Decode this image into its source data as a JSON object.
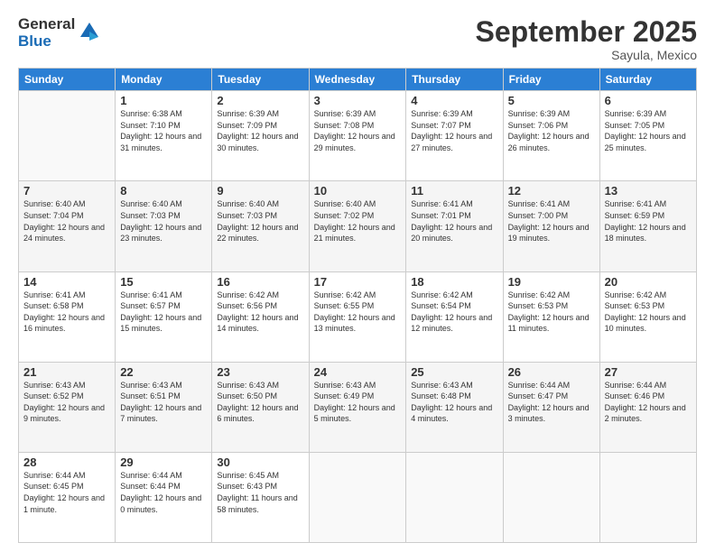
{
  "header": {
    "logo_general": "General",
    "logo_blue": "Blue",
    "month_title": "September 2025",
    "location": "Sayula, Mexico"
  },
  "days_of_week": [
    "Sunday",
    "Monday",
    "Tuesday",
    "Wednesday",
    "Thursday",
    "Friday",
    "Saturday"
  ],
  "weeks": [
    [
      {
        "day": "",
        "sunrise": "",
        "sunset": "",
        "daylight": ""
      },
      {
        "day": "1",
        "sunrise": "Sunrise: 6:38 AM",
        "sunset": "Sunset: 7:10 PM",
        "daylight": "Daylight: 12 hours and 31 minutes."
      },
      {
        "day": "2",
        "sunrise": "Sunrise: 6:39 AM",
        "sunset": "Sunset: 7:09 PM",
        "daylight": "Daylight: 12 hours and 30 minutes."
      },
      {
        "day": "3",
        "sunrise": "Sunrise: 6:39 AM",
        "sunset": "Sunset: 7:08 PM",
        "daylight": "Daylight: 12 hours and 29 minutes."
      },
      {
        "day": "4",
        "sunrise": "Sunrise: 6:39 AM",
        "sunset": "Sunset: 7:07 PM",
        "daylight": "Daylight: 12 hours and 27 minutes."
      },
      {
        "day": "5",
        "sunrise": "Sunrise: 6:39 AM",
        "sunset": "Sunset: 7:06 PM",
        "daylight": "Daylight: 12 hours and 26 minutes."
      },
      {
        "day": "6",
        "sunrise": "Sunrise: 6:39 AM",
        "sunset": "Sunset: 7:05 PM",
        "daylight": "Daylight: 12 hours and 25 minutes."
      }
    ],
    [
      {
        "day": "7",
        "sunrise": "Sunrise: 6:40 AM",
        "sunset": "Sunset: 7:04 PM",
        "daylight": "Daylight: 12 hours and 24 minutes."
      },
      {
        "day": "8",
        "sunrise": "Sunrise: 6:40 AM",
        "sunset": "Sunset: 7:03 PM",
        "daylight": "Daylight: 12 hours and 23 minutes."
      },
      {
        "day": "9",
        "sunrise": "Sunrise: 6:40 AM",
        "sunset": "Sunset: 7:03 PM",
        "daylight": "Daylight: 12 hours and 22 minutes."
      },
      {
        "day": "10",
        "sunrise": "Sunrise: 6:40 AM",
        "sunset": "Sunset: 7:02 PM",
        "daylight": "Daylight: 12 hours and 21 minutes."
      },
      {
        "day": "11",
        "sunrise": "Sunrise: 6:41 AM",
        "sunset": "Sunset: 7:01 PM",
        "daylight": "Daylight: 12 hours and 20 minutes."
      },
      {
        "day": "12",
        "sunrise": "Sunrise: 6:41 AM",
        "sunset": "Sunset: 7:00 PM",
        "daylight": "Daylight: 12 hours and 19 minutes."
      },
      {
        "day": "13",
        "sunrise": "Sunrise: 6:41 AM",
        "sunset": "Sunset: 6:59 PM",
        "daylight": "Daylight: 12 hours and 18 minutes."
      }
    ],
    [
      {
        "day": "14",
        "sunrise": "Sunrise: 6:41 AM",
        "sunset": "Sunset: 6:58 PM",
        "daylight": "Daylight: 12 hours and 16 minutes."
      },
      {
        "day": "15",
        "sunrise": "Sunrise: 6:41 AM",
        "sunset": "Sunset: 6:57 PM",
        "daylight": "Daylight: 12 hours and 15 minutes."
      },
      {
        "day": "16",
        "sunrise": "Sunrise: 6:42 AM",
        "sunset": "Sunset: 6:56 PM",
        "daylight": "Daylight: 12 hours and 14 minutes."
      },
      {
        "day": "17",
        "sunrise": "Sunrise: 6:42 AM",
        "sunset": "Sunset: 6:55 PM",
        "daylight": "Daylight: 12 hours and 13 minutes."
      },
      {
        "day": "18",
        "sunrise": "Sunrise: 6:42 AM",
        "sunset": "Sunset: 6:54 PM",
        "daylight": "Daylight: 12 hours and 12 minutes."
      },
      {
        "day": "19",
        "sunrise": "Sunrise: 6:42 AM",
        "sunset": "Sunset: 6:53 PM",
        "daylight": "Daylight: 12 hours and 11 minutes."
      },
      {
        "day": "20",
        "sunrise": "Sunrise: 6:42 AM",
        "sunset": "Sunset: 6:53 PM",
        "daylight": "Daylight: 12 hours and 10 minutes."
      }
    ],
    [
      {
        "day": "21",
        "sunrise": "Sunrise: 6:43 AM",
        "sunset": "Sunset: 6:52 PM",
        "daylight": "Daylight: 12 hours and 9 minutes."
      },
      {
        "day": "22",
        "sunrise": "Sunrise: 6:43 AM",
        "sunset": "Sunset: 6:51 PM",
        "daylight": "Daylight: 12 hours and 7 minutes."
      },
      {
        "day": "23",
        "sunrise": "Sunrise: 6:43 AM",
        "sunset": "Sunset: 6:50 PM",
        "daylight": "Daylight: 12 hours and 6 minutes."
      },
      {
        "day": "24",
        "sunrise": "Sunrise: 6:43 AM",
        "sunset": "Sunset: 6:49 PM",
        "daylight": "Daylight: 12 hours and 5 minutes."
      },
      {
        "day": "25",
        "sunrise": "Sunrise: 6:43 AM",
        "sunset": "Sunset: 6:48 PM",
        "daylight": "Daylight: 12 hours and 4 minutes."
      },
      {
        "day": "26",
        "sunrise": "Sunrise: 6:44 AM",
        "sunset": "Sunset: 6:47 PM",
        "daylight": "Daylight: 12 hours and 3 minutes."
      },
      {
        "day": "27",
        "sunrise": "Sunrise: 6:44 AM",
        "sunset": "Sunset: 6:46 PM",
        "daylight": "Daylight: 12 hours and 2 minutes."
      }
    ],
    [
      {
        "day": "28",
        "sunrise": "Sunrise: 6:44 AM",
        "sunset": "Sunset: 6:45 PM",
        "daylight": "Daylight: 12 hours and 1 minute."
      },
      {
        "day": "29",
        "sunrise": "Sunrise: 6:44 AM",
        "sunset": "Sunset: 6:44 PM",
        "daylight": "Daylight: 12 hours and 0 minutes."
      },
      {
        "day": "30",
        "sunrise": "Sunrise: 6:45 AM",
        "sunset": "Sunset: 6:43 PM",
        "daylight": "Daylight: 11 hours and 58 minutes."
      },
      {
        "day": "",
        "sunrise": "",
        "sunset": "",
        "daylight": ""
      },
      {
        "day": "",
        "sunrise": "",
        "sunset": "",
        "daylight": ""
      },
      {
        "day": "",
        "sunrise": "",
        "sunset": "",
        "daylight": ""
      },
      {
        "day": "",
        "sunrise": "",
        "sunset": "",
        "daylight": ""
      }
    ]
  ]
}
